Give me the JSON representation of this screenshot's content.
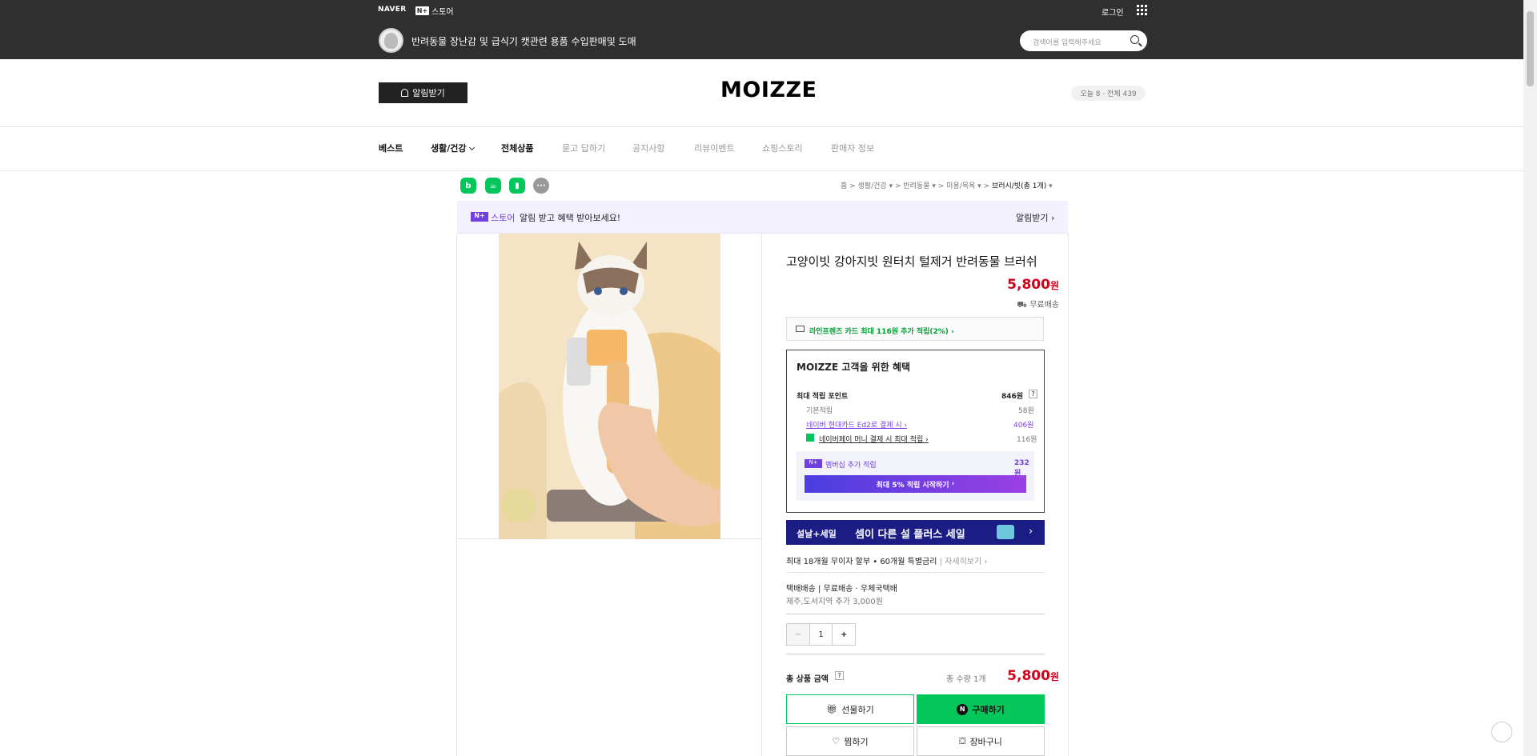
{
  "header": {
    "naver": "NAVER",
    "plus_mark": "N+",
    "store_label": "스토어",
    "login": "로그인",
    "store_name": "반려동물 장난감 및 급식기 캣관련 용품 수입판매및 도매",
    "search_placeholder": "검색어를 입력해주세요"
  },
  "brand": {
    "alarm_button": "알림받기",
    "logo": "MOIZZE",
    "visits": "오늘 8 · 전체 439"
  },
  "nav": {
    "items": [
      "베스트",
      "생활/건강",
      "전체상품",
      "묻고 답하기",
      "공지사항",
      "리뷰이벤트",
      "쇼핑스토리",
      "판매자 정보"
    ]
  },
  "share_icons": [
    "blog-icon",
    "cafe-icon",
    "bookmark-icon",
    "more-icon"
  ],
  "breadcrumb": [
    "홈",
    "생활/건강",
    "반려동물",
    "미용/목욕",
    "브러시/빗(총 1개)"
  ],
  "promo": {
    "brand": "스토어",
    "text": "알림 받고 혜택 받아보세요!",
    "action": "알림받기"
  },
  "product": {
    "title": "고양이빗 강아지빗 원터치 털제거 반려동물 브러쉬",
    "price": "5,800",
    "price_unit": "원",
    "shipping": "무료배송",
    "card_benefit": "라인프렌즈 카드 최대 116원 추가 적립(2%)",
    "benefit": {
      "title": "MOIZZE 고객을 위한 혜택",
      "max_label": "최대 적립 포인트",
      "max_value": "846원",
      "q": "?",
      "rows": [
        {
          "label": "기본적립",
          "value": "58원"
        },
        {
          "label": "네이버 현대카드 Ed2로 결제 시",
          "value": "406원"
        },
        {
          "label": "네이버페이 머니 결제 시 최대 적립",
          "value": "116원"
        }
      ],
      "membership_label": "멤버십 추가 적립",
      "membership_value": "232원",
      "membership_button": "최대 5% 적립 시작하기"
    },
    "sale_tag": "설날+세일",
    "sale_title": "셈이 다른 설 플러스 세일",
    "installment": "최대 18개월 무이자 할부 • 60개월 특별금리",
    "installment_more": "자세히보기",
    "delivery": {
      "type": "택배배송",
      "fee": "무료배송",
      "carrier": "우체국택배",
      "extra": "제주,도서지역 추가 3,000원"
    },
    "quantity": "1",
    "minus": "−",
    "plus": "+",
    "total_label": "총 상품 금액",
    "total_count": "총 수량 1개",
    "total_price": "5,800",
    "total_unit": "원",
    "buttons": {
      "gift": "선물하기",
      "buy": "구매하기",
      "wish": "찜하기",
      "cart": "장바구니"
    }
  },
  "colors": {
    "naver_green": "#03c75a",
    "price_red": "#d0021b",
    "sale_navy": "#1b1d84",
    "purple": "#7b3fe4"
  }
}
